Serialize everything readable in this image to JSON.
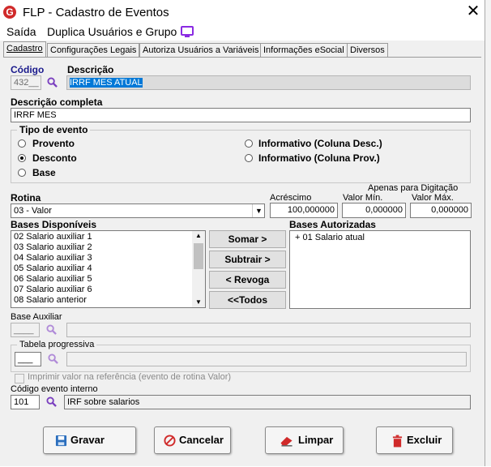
{
  "window": {
    "title": "FLP - Cadastro de Eventos",
    "logo_letter": "G",
    "close": "✕"
  },
  "menu": {
    "items": [
      "Saída",
      "Duplica Usuários e Grupo"
    ]
  },
  "tabs": [
    "Cadastro",
    "Configurações Legais",
    "Autoriza Usuários a Variáveis",
    "Informações eSocial",
    "Diversos"
  ],
  "form": {
    "codigo_label": "Código",
    "codigo_value": "432__",
    "descricao_label": "Descrição",
    "descricao_value": "IRRF MES ATUAL",
    "desc_completa_label": "Descrição completa",
    "desc_completa_value": "IRRF MES",
    "tipo_evento": {
      "legend": "Tipo de evento",
      "options": [
        "Provento",
        "Desconto",
        "Base",
        "Informativo (Coluna Desc.)",
        "Informativo (Coluna Prov.)"
      ],
      "selected": "Desconto"
    },
    "apenas_label": "Apenas para Digitação",
    "rotina_label": "Rotina",
    "rotina_value": "03 - Valor",
    "acrescimo_label": "Acréscimo",
    "acrescimo_value": "100,000000",
    "valor_min_label": "Valor Mín.",
    "valor_min_value": "0,000000",
    "valor_max_label": "Valor Máx.",
    "valor_max_value": "0,000000",
    "bases_disponiveis_label": "Bases Disponíveis",
    "bases_disponiveis": [
      "02 Salario auxiliar 1",
      "03 Salario auxiliar 2",
      "04 Salario auxiliar 3",
      "05 Salario auxiliar 4",
      "06 Salario auxiliar 5",
      "07 Salario auxiliar 6",
      "08 Salario anterior"
    ],
    "bases_autorizadas_label": "Bases Autorizadas",
    "bases_autorizadas": [
      "+ 01 Salario atual"
    ],
    "btn_somar": "Somar >",
    "btn_subtrair": "Subtrair >",
    "btn_revoga": "< Revoga",
    "btn_todos": "<<Todos",
    "base_auxiliar_label": "Base Auxiliar",
    "base_auxiliar_value": "____",
    "tabela_label": "Tabela progressiva",
    "tabela_value": "___",
    "imprimir_label": "Imprimir valor na referência (evento de rotina Valor)",
    "codigo_interno_label": "Código evento interno",
    "codigo_interno_value": "101",
    "codigo_interno_desc": "IRF sobre salarios"
  },
  "footer": {
    "gravar": "Gravar",
    "cancelar": "Cancelar",
    "limpar": "Limpar",
    "excluir": "Excluir"
  },
  "colors": {
    "accent": "#0078d7",
    "brand": "#d02a2a",
    "title_link": "#1a1a8c"
  }
}
